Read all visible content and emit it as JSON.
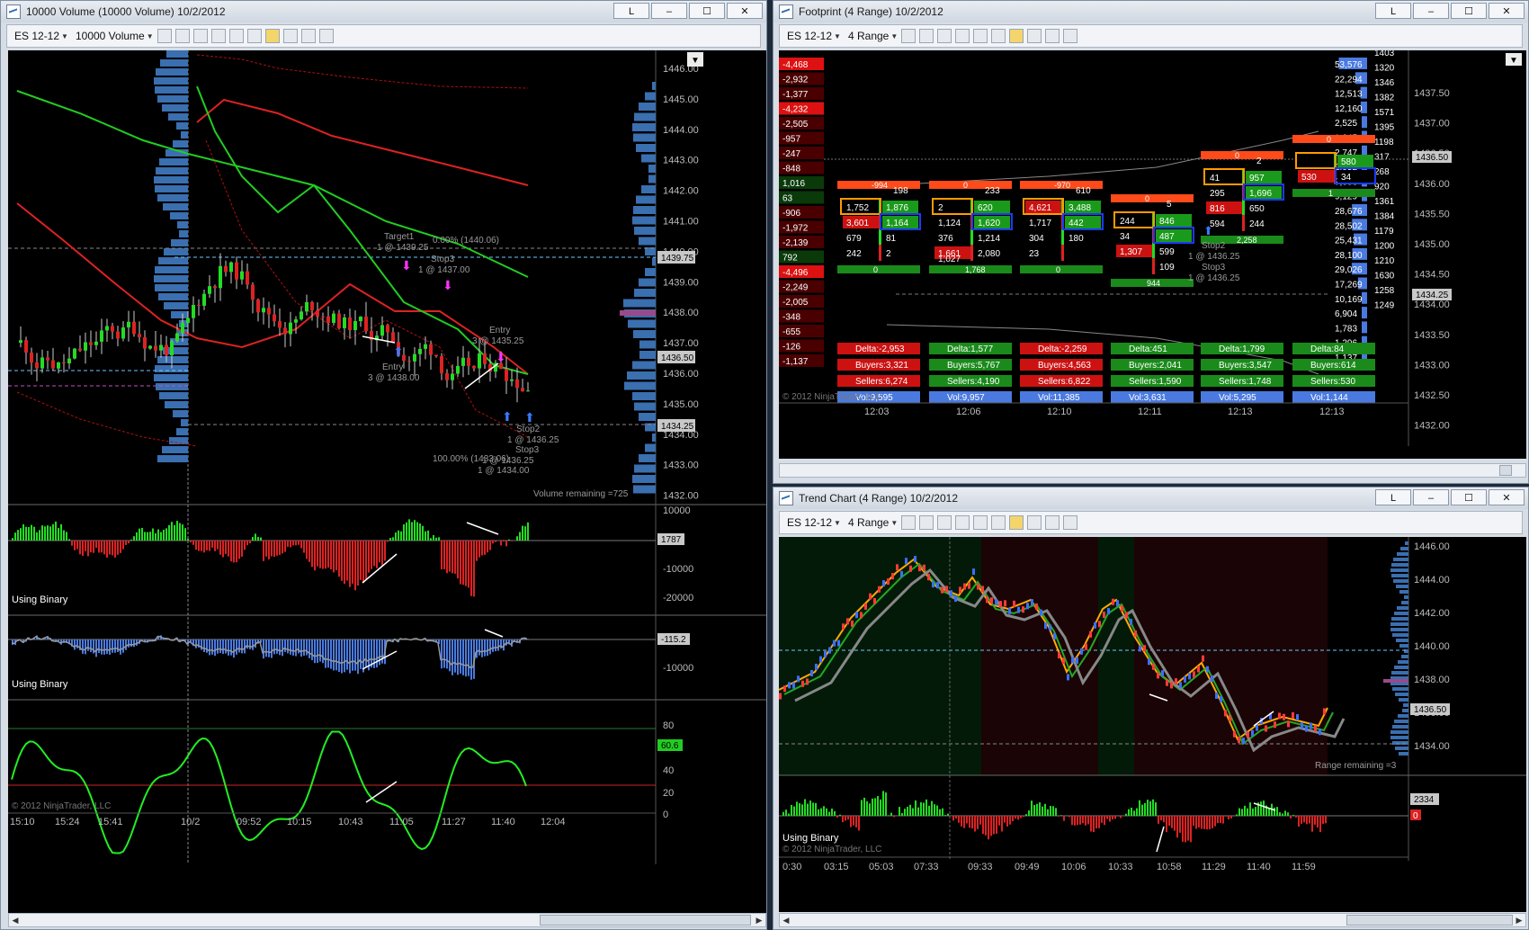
{
  "w1": {
    "title": "10000 Volume (10000 Volume)  10/2/2012",
    "instrument": "ES 12-12",
    "period": "10000 Volume",
    "btn_link": "L",
    "price_ticks": [
      "1446.00",
      "1445.00",
      "1444.00",
      "1443.00",
      "1442.00",
      "1441.00",
      "1440.00",
      "1439.00",
      "1438.00",
      "1437.00",
      "1436.00",
      "1435.00",
      "1434.00",
      "1433.00",
      "1432.00"
    ],
    "price_badges": {
      "a": "1439.75",
      "b": "1436.50",
      "c": "1434.25"
    },
    "volume_remaining": "Volume remaining =725",
    "target1": "Target1",
    "target1_val": "1 @ 1439.25",
    "stop_pct": "0.00% (1440.06)",
    "stop3": "Stop3",
    "stop3_val": "1 @ 1437.00",
    "stop3_val2": "1 @ 1437.00",
    "entry_a": "Entry",
    "entry_a_val": "3 @ 1438.00",
    "entry_b": "Entry",
    "entry_b_val": "3 @ 1435.25",
    "stop2": "Stop2",
    "stop2_val": "1 @ 1436.25",
    "stop3b": "Stop3",
    "stop3b_val": "1 @ 1436.25",
    "pct_b": "100.00% (1433.06)",
    "stop_b_val": "1 @ 1434.00",
    "ind1_ticks": [
      "10000",
      "0",
      "-10000",
      "-20000"
    ],
    "ind1_badge": "1787",
    "ind1_label": "Using Binary",
    "ind2_ticks": [
      "0",
      "-10000"
    ],
    "ind2_badge": "-115.2",
    "ind2_label": "Using Binary",
    "ind3_ticks": [
      "80",
      "60",
      "40",
      "20",
      "0"
    ],
    "ind3_badge": "60.6",
    "copyright": "© 2012 NinjaTrader, LLC",
    "time_ticks": [
      "15:10",
      "15:24",
      "15:41",
      "10/2",
      "09:52",
      "10:15",
      "10:43",
      "11:05",
      "11:27",
      "11:40",
      "12:04"
    ]
  },
  "w2": {
    "title": "Footprint (4 Range)  10/2/2012",
    "instrument": "ES 12-12",
    "period": "4 Range",
    "btn_link": "L",
    "left_deltas": [
      "-4,468",
      "-2,932",
      "-1,377",
      "-4,232",
      "-2,505",
      "-957",
      "-247",
      "-848",
      "1,016",
      "63",
      "-906",
      "-1,972",
      "-2,139",
      "792",
      "-4,496",
      "-2,249",
      "-2,005",
      "-348",
      "-655",
      "-126",
      "-1,137"
    ],
    "right_vols": [
      "53,576",
      "22,294",
      "12,513",
      "12,160",
      "2,525",
      "1,045",
      "2,747",
      "2,952",
      "7,006",
      "9,129",
      "28,676",
      "28,502",
      "25,431",
      "28,100",
      "29,026",
      "17,269",
      "10,169",
      "6,904",
      "1,783",
      "1,296",
      "1,137"
    ],
    "right_counts": [
      "1403",
      "1320",
      "1346",
      "1382",
      "1571",
      "1395",
      "1198",
      "317",
      "268",
      "920",
      "1361",
      "1384",
      "1179",
      "1200",
      "1210",
      "1630",
      "1258",
      "1249"
    ],
    "price_ticks": [
      "1437.50",
      "1437.00",
      "1436.50",
      "1436.00",
      "1435.50",
      "1435.00",
      "1434.50",
      "1434.00",
      "1433.50",
      "1433.00",
      "1432.50",
      "1432.00"
    ],
    "price_badge_a": "1436.50",
    "price_badge_b": "1434.25",
    "bars": [
      {
        "top": "-994",
        "cells": [
          [
            "1,752",
            "1,876"
          ],
          [
            "3,601",
            "1,164"
          ],
          [
            "679",
            "81"
          ],
          [
            "242",
            "2"
          ]
        ],
        "bottom": "0",
        "delta": "Delta:-2,953",
        "buyers": "Buyers:3,321",
        "sellers": "Sellers:6,274",
        "vol": "Vol:9,595",
        "time": "12:03",
        "extra": "198"
      },
      {
        "top": "0",
        "cells": [
          [
            "2",
            "620"
          ],
          [
            "1,124",
            "1,620"
          ],
          [
            "376",
            "1,214"
          ],
          [
            "1,661",
            "2,080"
          ]
        ],
        "bottom": "1,768",
        "delta": "Delta:1,577",
        "buyers": "Buyers:5,767",
        "sellers": "Sellers:4,190",
        "vol": "Vol:9,957",
        "time": "12:06",
        "extra": "233",
        "extra2": "1,027"
      },
      {
        "top": "-970",
        "cells": [
          [
            "4,621",
            "3,488"
          ],
          [
            "1,717",
            "442"
          ],
          [
            "304",
            "180"
          ],
          [
            "23",
            ""
          ]
        ],
        "bottom": "0",
        "delta": "Delta:-2,259",
        "buyers": "Buyers:4,563",
        "sellers": "Sellers:6,822",
        "vol": "Vol:11,385",
        "time": "12:10",
        "extra": "610"
      },
      {
        "top": "0",
        "cells": [
          [
            "244",
            "846"
          ],
          [
            "34",
            "487"
          ],
          [
            "1,307",
            "599"
          ],
          [
            "",
            "109"
          ]
        ],
        "bottom": "944",
        "delta": "Delta:451",
        "buyers": "Buyers:2,041",
        "sellers": "Sellers:1,590",
        "vol": "Vol:3,631",
        "time": "12:11",
        "extra": "5"
      },
      {
        "top": "0",
        "cells": [
          [
            "41",
            "957"
          ],
          [
            "295",
            "1,696"
          ],
          [
            "816",
            "650"
          ],
          [
            "594",
            "244"
          ]
        ],
        "bottom": "2,258",
        "delta": "Delta:1,799",
        "buyers": "Buyers:3,547",
        "sellers": "Sellers:1,748",
        "vol": "Vol:5,295",
        "time": "12:13",
        "extra": "2"
      },
      {
        "top": "0",
        "cells": [
          [
            "",
            "580"
          ],
          [
            "530",
            "34"
          ]
        ],
        "bottom": "1",
        "delta": "Delta:84",
        "buyers": "Buyers:614",
        "sellers": "Sellers:530",
        "vol": "Vol:1,144",
        "time": "12:13",
        "extra": ""
      }
    ],
    "stop2": "Stop2",
    "stop2_val": "1 @ 1436.25",
    "stop3": "Stop3",
    "stop3_val": "1 @ 1436.25",
    "copyright": "© 2012 NinjaTrader, LLC"
  },
  "w3": {
    "title": "Trend Chart (4 Range)  10/2/2012",
    "instrument": "ES 12-12",
    "period": "4 Range",
    "btn_link": "L",
    "price_ticks": [
      "1446.00",
      "1444.00",
      "1442.00",
      "1440.00",
      "1438.00",
      "1436.00",
      "1434.00"
    ],
    "price_badge": "1436.50",
    "range_remaining": "Range remaining =3",
    "ind_badge": "2334",
    "ind_badge2": "0",
    "ind_label": "Using Binary",
    "copyright": "© 2012 NinjaTrader, LLC",
    "time_ticks": [
      "0:30",
      "03:15",
      "05:03",
      "07:33",
      "09:33",
      "09:49",
      "10:06",
      "10:33",
      "10:58",
      "11:29",
      "11:40",
      "11:59"
    ]
  }
}
